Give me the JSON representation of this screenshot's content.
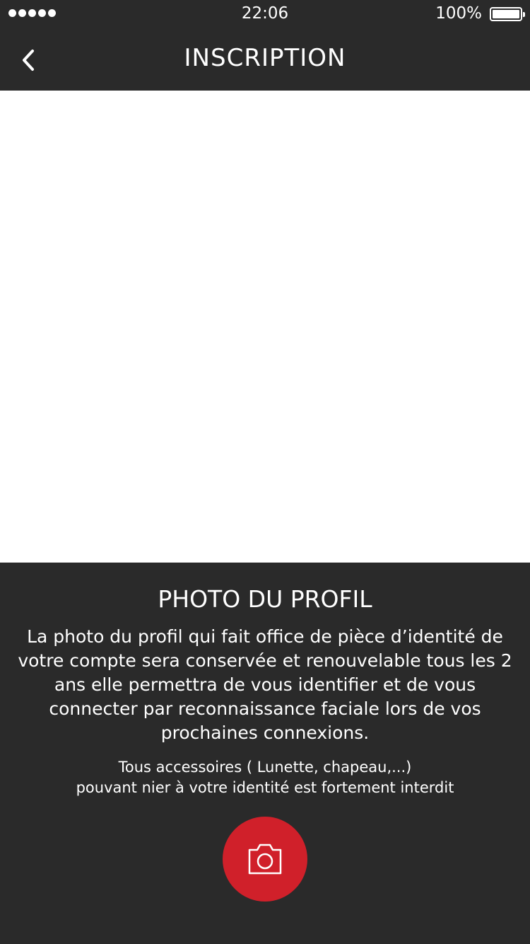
{
  "status_bar": {
    "time": "22:06",
    "battery_percent": "100%",
    "signal_bars": 5
  },
  "nav": {
    "title": "INSCRIPTION",
    "back_icon": "chevron-left-icon"
  },
  "profile_photo": {
    "title": "PHOTO DU PROFIL",
    "description": "La photo du profil qui fait office de pièce d’identité de votre compte sera conservée et renouvelable tous les 2 ans elle permettra de vous identifier et de vous connecter par reconnaissance faciale lors de vos prochaines connexions.",
    "warning_line1": "Tous accessoires ( Lunette, chapeau,...)",
    "warning_line2": "pouvant nier  à votre identité est fortement interdit",
    "camera_icon": "camera-icon"
  },
  "colors": {
    "background": "#2a2a2a",
    "photo_area": "#ffffff",
    "accent": "#d0202a",
    "text": "#ffffff"
  }
}
